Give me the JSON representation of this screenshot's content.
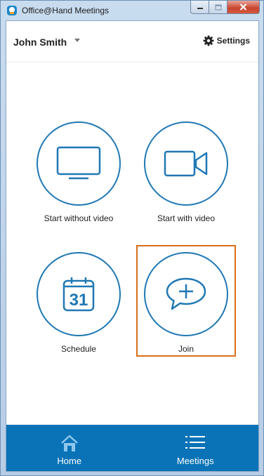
{
  "window": {
    "title": "Office@Hand Meetings"
  },
  "header": {
    "user_name": "John Smith",
    "settings_label": "Settings"
  },
  "actions": [
    {
      "id": "start-without-video",
      "label": "Start without video",
      "icon": "monitor-icon"
    },
    {
      "id": "start-with-video",
      "label": "Start with video",
      "icon": "video-camera-icon"
    },
    {
      "id": "schedule",
      "label": "Schedule",
      "icon": "calendar-icon",
      "calendar_day": "31"
    },
    {
      "id": "join",
      "label": "Join",
      "icon": "chat-plus-icon",
      "highlighted": true
    }
  ],
  "bottom_nav": [
    {
      "id": "home",
      "label": "Home",
      "icon": "home-icon",
      "active": true
    },
    {
      "id": "meetings",
      "label": "Meetings",
      "icon": "list-icon",
      "active": false
    }
  ],
  "colors": {
    "accent": "#1f78b4",
    "nav_bar": "#0a73b7",
    "highlight_border": "#d86f17",
    "close_button": "#c8432e"
  }
}
